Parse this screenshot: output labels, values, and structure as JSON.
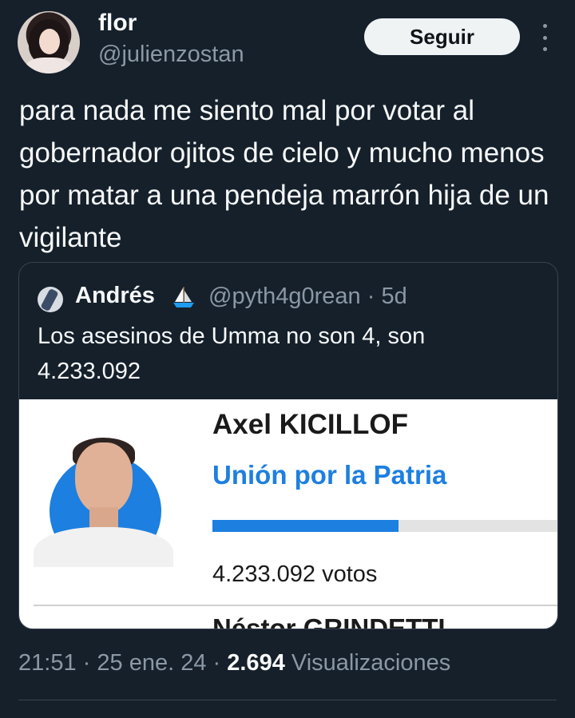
{
  "author": {
    "name": "flor",
    "handle": "@julienzostan",
    "avatar_icon": "profile-avatar"
  },
  "follow_button": {
    "label": "Seguir"
  },
  "more_icon": "more-vertical-icon",
  "tweet": {
    "text": "para nada me siento mal por votar al gobernador ojitos de cielo y mucho menos por matar a una pendeja marrón hija de un vigilante"
  },
  "quote": {
    "name": "Andrés",
    "emoji_icon": "sailboat-icon",
    "handle": "@pyth4g0rean",
    "separator": "·",
    "age": "5d",
    "text": "Los asesinos de Umma no son 4, son 4.233.092",
    "card": {
      "candidate_name": "Axel KICILLOF",
      "party": "Unión por la Patria",
      "votes": "4.233.092 votos",
      "vote_share": 0.54,
      "next_candidate_partial": "Néstor GRINDETTI",
      "party_color": "#1d7fe0"
    }
  },
  "meta": {
    "time": "21:51",
    "sep1": "·",
    "date": "25 ene. 24",
    "sep2": "·",
    "views_count": "2.694",
    "views_label": "Visualizaciones"
  },
  "colors": {
    "background": "#15202b",
    "text": "#f7f9f9",
    "muted": "#8b98a5",
    "border": "#38444d"
  }
}
